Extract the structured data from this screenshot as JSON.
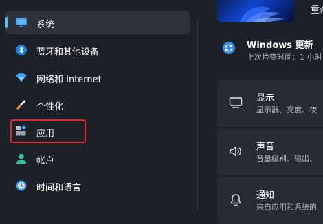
{
  "sidebar": {
    "items": [
      {
        "label": "系统",
        "icon": "monitor-icon",
        "active": true
      },
      {
        "label": "蓝牙和其他设备",
        "icon": "bluetooth-icon"
      },
      {
        "label": "网络和 Internet",
        "icon": "wifi-icon"
      },
      {
        "label": "个性化",
        "icon": "brush-icon"
      },
      {
        "label": "应用",
        "icon": "apps-icon",
        "highlighted": true
      },
      {
        "label": "帐户",
        "icon": "person-icon"
      },
      {
        "label": "时间和语言",
        "icon": "globe-clock-icon"
      }
    ]
  },
  "header": {
    "user_name_fragment": "重命"
  },
  "windows_update": {
    "title": "Windows 更新",
    "subtitle": "上次检查时间：1 小时"
  },
  "cards": [
    {
      "title": "显示",
      "subtitle": "显示器、亮度、夜",
      "icon": "display-icon"
    },
    {
      "title": "声音",
      "subtitle": "音量级别、输出、",
      "icon": "speaker-icon"
    },
    {
      "title": "通知",
      "subtitle": "来自应用和系统的",
      "icon": "bell-icon"
    }
  ],
  "colors": {
    "background": "#1c2027",
    "accent": "#4cc2ff",
    "selected_bg": "#2d3139",
    "card_bg": "#272b33",
    "highlight_box": "#e0282e"
  }
}
